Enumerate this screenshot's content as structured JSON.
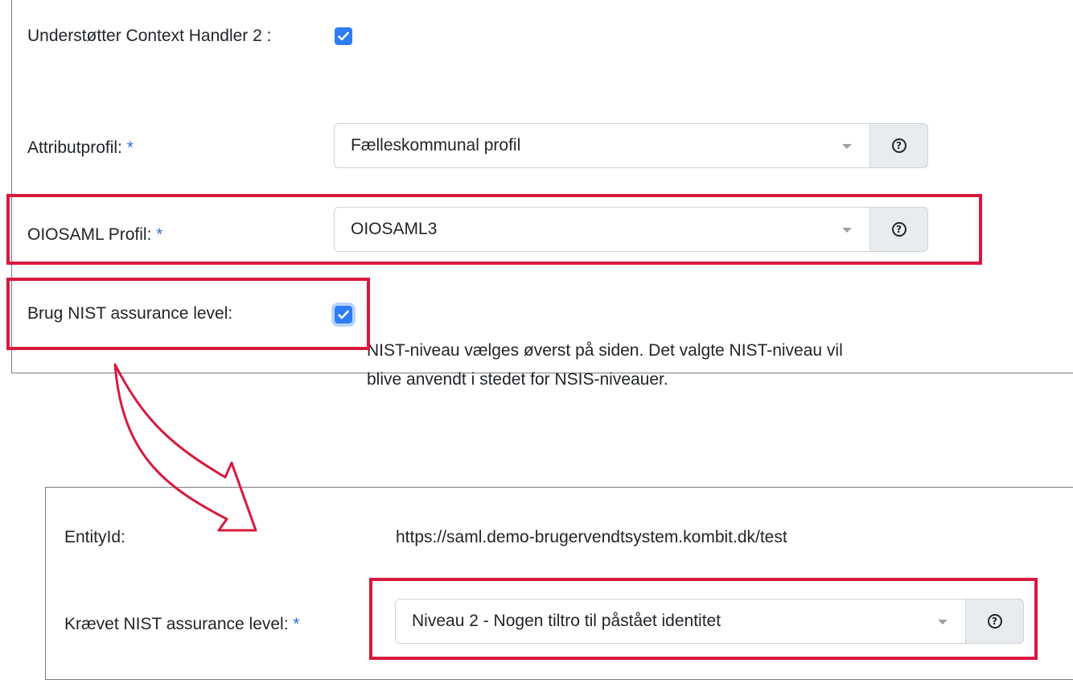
{
  "top_panel": {
    "context_handler": {
      "label": "Understøtter Context Handler 2 :",
      "checked": true
    },
    "attribute_profile": {
      "label": "Attributprofil:",
      "required_mark": "*",
      "value": "Fælleskommunal profil",
      "help_icon": "question-circle-icon"
    },
    "oiosaml_profile": {
      "label": "OIOSAML Profil:",
      "required_mark": "*",
      "value": "OIOSAML3",
      "help_icon": "question-circle-icon"
    },
    "nist_assurance": {
      "label": "Brug NIST assurance level:",
      "checked": true,
      "help_text_line1": "NIST-niveau vælges øverst på siden. Det valgte NIST-niveau vil",
      "help_text_line2": "blive anvendt i stedet for NSIS-niveauer."
    }
  },
  "bottom_panel": {
    "entity_id": {
      "label": "EntityId:",
      "value": "https://saml.demo-brugervendtsystem.kombit.dk/test"
    },
    "required_nist": {
      "label": "Krævet NIST assurance level:",
      "required_mark": "*",
      "value": "Niveau 2 - Nogen tiltro til påstået identitet",
      "help_icon": "question-circle-icon"
    }
  },
  "colors": {
    "highlight": "#d8193f",
    "checkbox": "#2d7cf6",
    "required": "#2f6fd1",
    "panel_border": "#7b7b7b"
  },
  "annotation": {
    "arrow": "curved-arrow-down-right"
  }
}
